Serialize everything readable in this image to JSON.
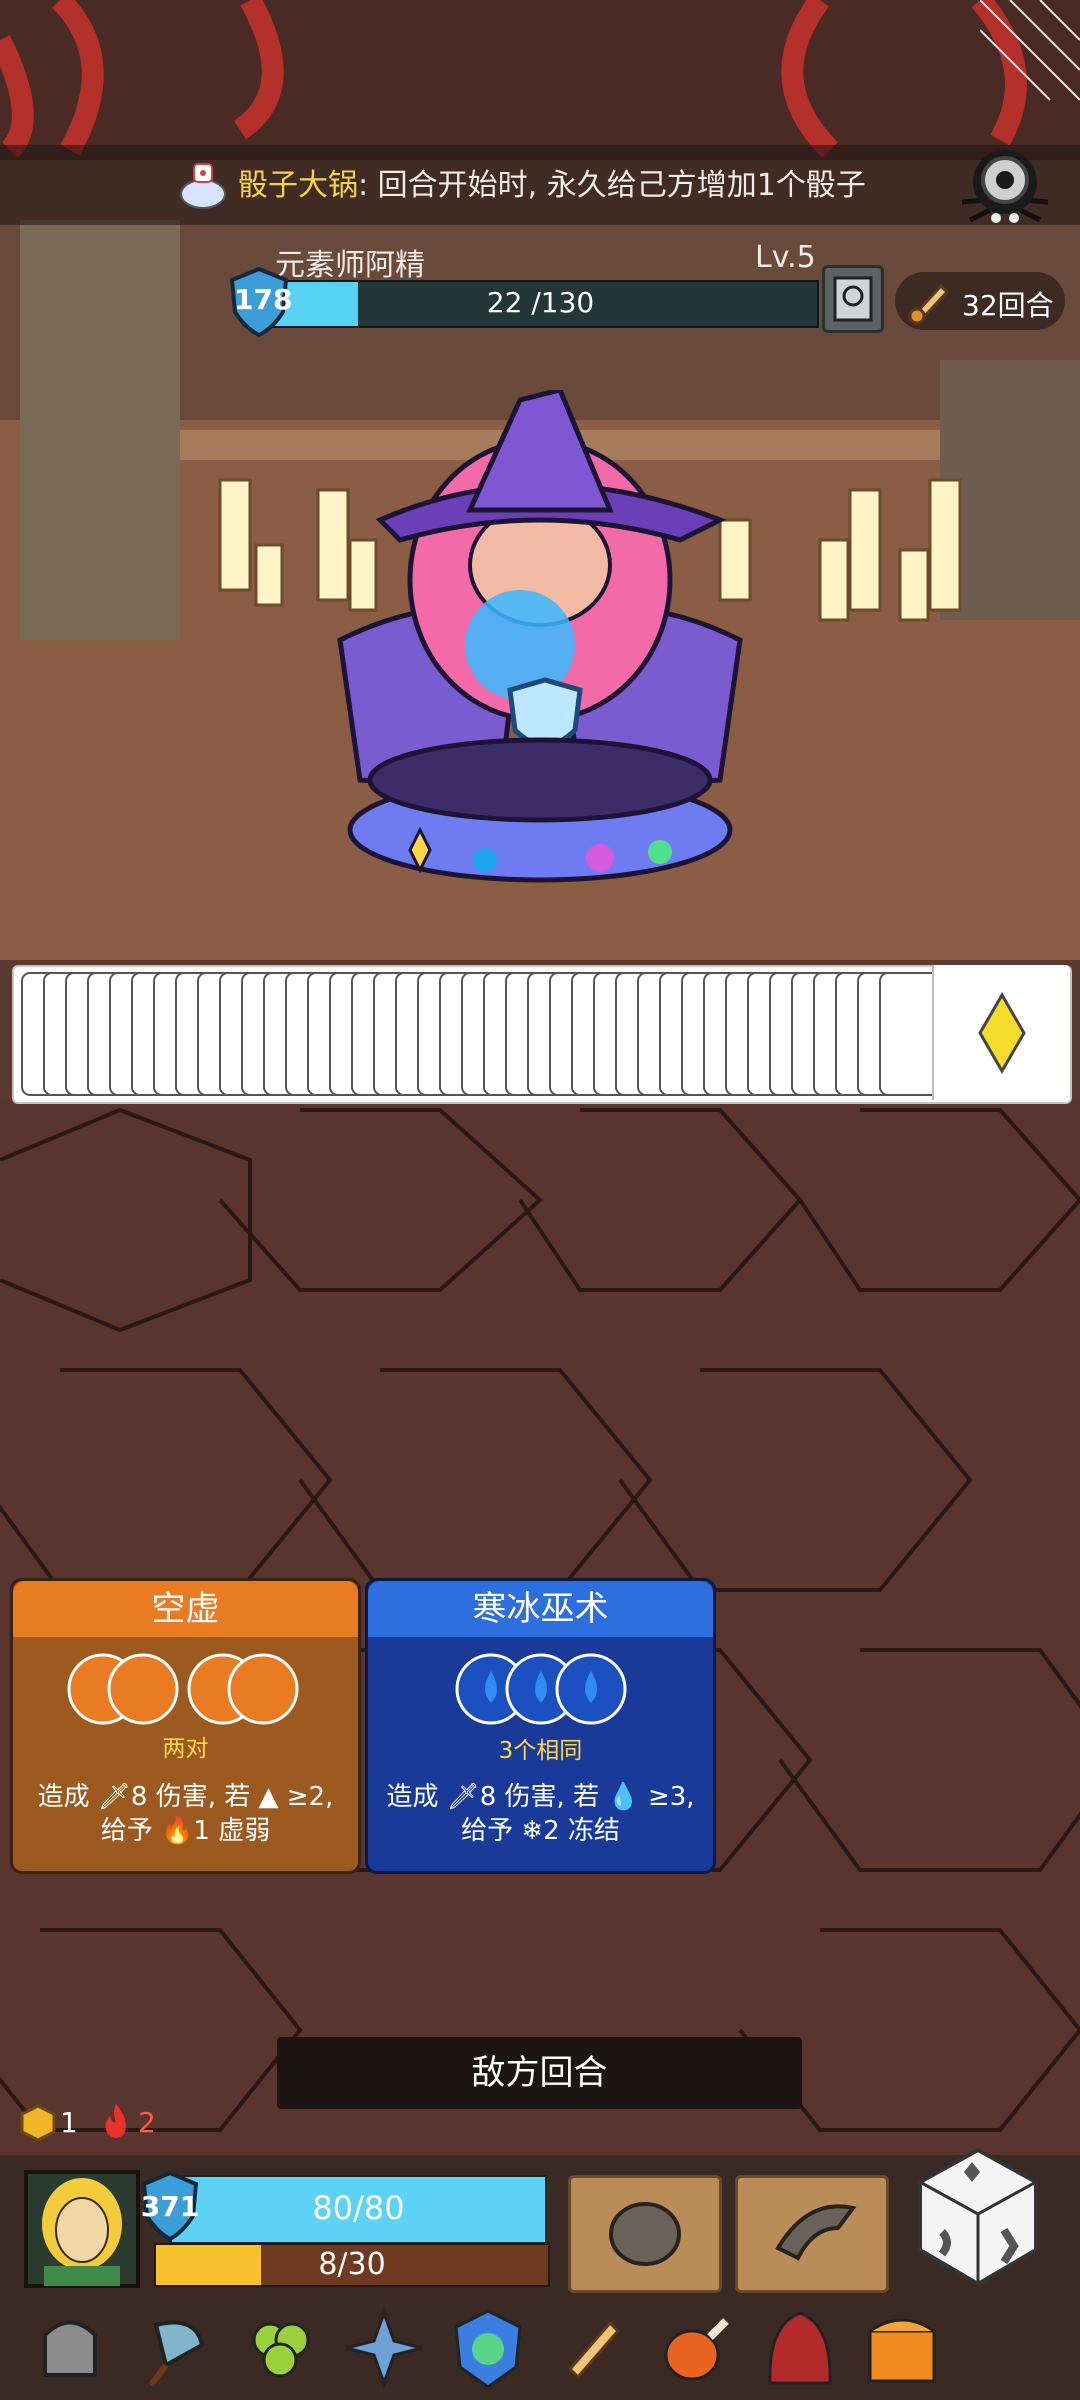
{
  "banner": {
    "name": "骰子大锅",
    "sep": ":",
    "text": "回合开始时, 永久给己方增加1个骰子"
  },
  "enemy": {
    "name": "元素师阿精",
    "level": "Lv.5",
    "armor": "178",
    "hp_text": "22 /130",
    "hp_current": 22,
    "hp_max": 130
  },
  "turns": "32回合",
  "dice_row": {
    "count": 40,
    "last_die": "diamond-yellow"
  },
  "cards": [
    {
      "title": "空虚",
      "requirement": "两对",
      "desc_line1": "造成 🗡8 伤害, 若 ▲ ≥2,",
      "desc_line2": "给予 🔥1 虚弱",
      "color": "#e97b23"
    },
    {
      "title": "寒冰巫术",
      "requirement": "3个相同",
      "desc_line1": "造成 🗡8 伤害, 若 💧 ≥3,",
      "desc_line2": "给予 ❄2 冻结",
      "color": "#2e6fe0"
    }
  ],
  "enemy_turn_label": "敌方回合",
  "status": {
    "gold": "1",
    "fire": "2"
  },
  "player": {
    "armor": "371",
    "hp_text": "80/80",
    "hp_current": 80,
    "hp_max": 80,
    "xp_text": "8/30",
    "xp_current": 8,
    "xp_max": 30
  },
  "inventory": [
    "helmet-icon",
    "axe-icon",
    "clover-icon",
    "compass-icon",
    "mask-icon",
    "scroll-icon",
    "meat-icon",
    "hood-icon",
    "chest-icon"
  ]
}
